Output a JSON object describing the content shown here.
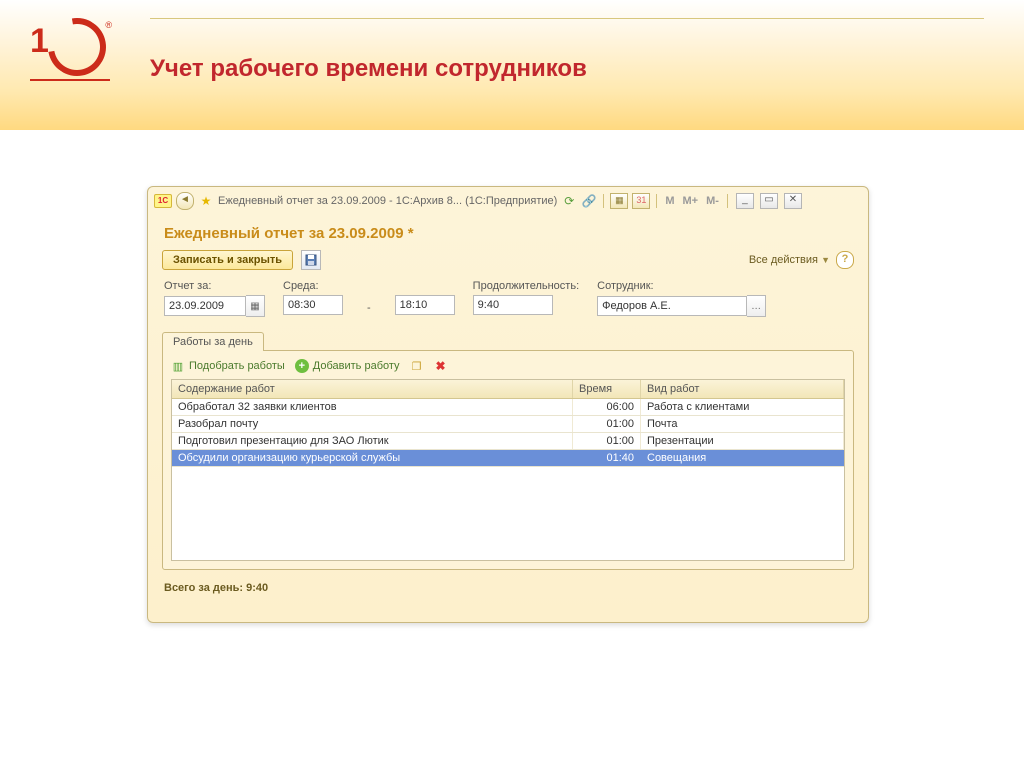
{
  "slide": {
    "title": "Учет рабочего времени сотрудников"
  },
  "titlebar": {
    "logo_text": "1C",
    "title": "Ежедневный отчет за 23.09.2009 - 1С:Архив 8... (1С:Предприятие)",
    "m1": "M",
    "m2": "M+",
    "m3": "M-"
  },
  "doc": {
    "title": "Ежедневный отчет за 23.09.2009 *"
  },
  "toolbar": {
    "submit_label": "Записать и закрыть",
    "all_actions": "Все действия"
  },
  "fields": {
    "date_lbl": "Отчет за:",
    "date_val": "23.09.2009",
    "from_lbl": "Среда:",
    "from_val": "08:30",
    "to_val": "18:10",
    "duration_lbl": "Продолжительность:",
    "duration_val": "9:40",
    "employee_lbl": "Сотрудник:",
    "employee_val": "Федоров А.Е."
  },
  "tab": {
    "label": "Работы за день"
  },
  "tab_toolbar": {
    "pick": "Подобрать работы",
    "add": "Добавить работу"
  },
  "grid": {
    "h1": "Содержание работ",
    "h2": "Время",
    "h3": "Вид работ",
    "rows": [
      {
        "c1": "Обработал 32 заявки клиентов",
        "c2": "06:00",
        "c3": "Работа с клиентами"
      },
      {
        "c1": "Разобрал почту",
        "c2": "01:00",
        "c3": "Почта"
      },
      {
        "c1": "Подготовил презентацию для ЗАО Лютик",
        "c2": "01:00",
        "c3": "Презентации"
      },
      {
        "c1": "Обсудили организацию курьерской службы",
        "c2": "01:40",
        "c3": "Совещания"
      }
    ],
    "selected_index": 3
  },
  "footer": {
    "total": "Всего за день: 9:40"
  }
}
